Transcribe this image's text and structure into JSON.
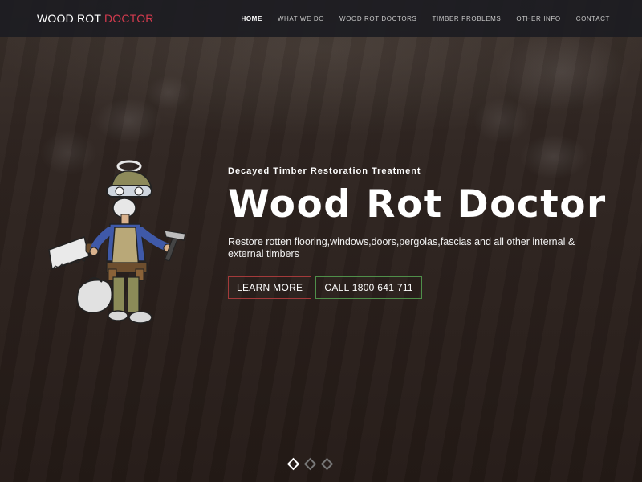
{
  "brand": {
    "primary": "WOOD ROT ",
    "accent": "DOCTOR",
    "accent_color": "#d23b4e"
  },
  "nav": {
    "items": [
      "HOME",
      "WHAT WE DO",
      "WOOD ROT DOCTORS",
      "TIMBER PROBLEMS",
      "OTHER INFO",
      "CONTACT"
    ],
    "active_index": 0
  },
  "hero": {
    "eyebrow": "Decayed Timber Restoration Treatment",
    "headline": "Wood Rot Doctor",
    "lede": "Restore rotten flooring,windows,doors,pergolas,fascias and all other internal & external timbers",
    "learn_more": "LEARN MORE",
    "call": "CALL 1800 641 711",
    "learn_border_color": "#a33a3a",
    "call_border_color": "#4f8f4a",
    "mascot_icon": "carpenter-mascot"
  },
  "carousel": {
    "slides": 3,
    "active_index": 0
  }
}
